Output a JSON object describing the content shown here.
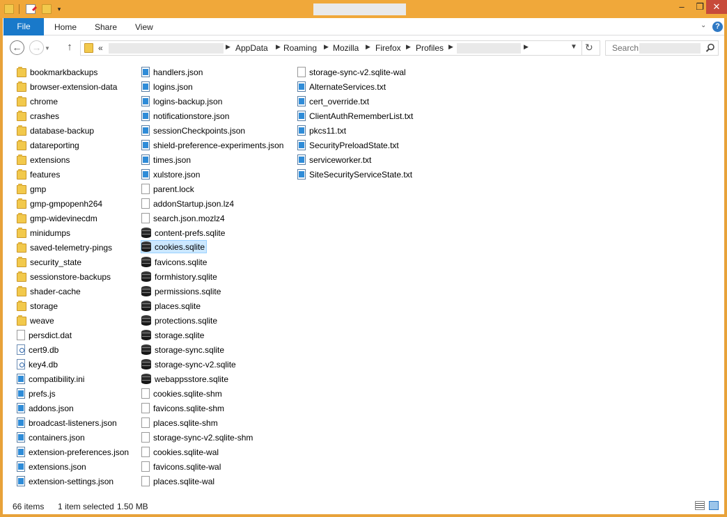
{
  "ribbon": {
    "file": "File",
    "home": "Home",
    "share": "Share",
    "view": "View",
    "help": "?"
  },
  "window": {
    "min": "–",
    "max": "❐",
    "close": "✕"
  },
  "nav": {
    "overflow": "«",
    "crumbs": [
      "AppData",
      "Roaming",
      "Mozilla",
      "Firefox",
      "Profiles"
    ],
    "search_placeholder": "Search"
  },
  "columns": [
    [
      {
        "name": "bookmarkbackups",
        "icon": "folder"
      },
      {
        "name": "browser-extension-data",
        "icon": "folder"
      },
      {
        "name": "chrome",
        "icon": "folder"
      },
      {
        "name": "crashes",
        "icon": "folder"
      },
      {
        "name": "database-backup",
        "icon": "folder"
      },
      {
        "name": "datareporting",
        "icon": "folder"
      },
      {
        "name": "extensions",
        "icon": "folder"
      },
      {
        "name": "features",
        "icon": "folder"
      },
      {
        "name": "gmp",
        "icon": "folder"
      },
      {
        "name": "gmp-gmpopenh264",
        "icon": "folder"
      },
      {
        "name": "gmp-widevinecdm",
        "icon": "folder"
      },
      {
        "name": "minidumps",
        "icon": "folder"
      },
      {
        "name": "saved-telemetry-pings",
        "icon": "folder"
      },
      {
        "name": "security_state",
        "icon": "folder"
      },
      {
        "name": "sessionstore-backups",
        "icon": "folder"
      },
      {
        "name": "shader-cache",
        "icon": "folder"
      },
      {
        "name": "storage",
        "icon": "folder"
      },
      {
        "name": "weave",
        "icon": "folder"
      },
      {
        "name": "persdict.dat",
        "icon": "doc"
      },
      {
        "name": "cert9.db",
        "icon": "cert"
      },
      {
        "name": "key4.db",
        "icon": "cert"
      },
      {
        "name": "compatibility.ini",
        "icon": "blue"
      },
      {
        "name": "prefs.js",
        "icon": "blue"
      },
      {
        "name": "addons.json",
        "icon": "blue"
      },
      {
        "name": "broadcast-listeners.json",
        "icon": "blue"
      },
      {
        "name": "containers.json",
        "icon": "blue"
      },
      {
        "name": "extension-preferences.json",
        "icon": "blue"
      },
      {
        "name": "extensions.json",
        "icon": "blue"
      },
      {
        "name": "extension-settings.json",
        "icon": "blue"
      }
    ],
    [
      {
        "name": "handlers.json",
        "icon": "blue"
      },
      {
        "name": "logins.json",
        "icon": "blue"
      },
      {
        "name": "logins-backup.json",
        "icon": "blue"
      },
      {
        "name": "notificationstore.json",
        "icon": "blue"
      },
      {
        "name": "sessionCheckpoints.json",
        "icon": "blue"
      },
      {
        "name": "shield-preference-experiments.json",
        "icon": "blue"
      },
      {
        "name": "times.json",
        "icon": "blue"
      },
      {
        "name": "xulstore.json",
        "icon": "blue"
      },
      {
        "name": "parent.lock",
        "icon": "doc"
      },
      {
        "name": "addonStartup.json.lz4",
        "icon": "doc"
      },
      {
        "name": "search.json.mozlz4",
        "icon": "doc"
      },
      {
        "name": "content-prefs.sqlite",
        "icon": "db"
      },
      {
        "name": "cookies.sqlite",
        "icon": "db",
        "selected": true
      },
      {
        "name": "favicons.sqlite",
        "icon": "db"
      },
      {
        "name": "formhistory.sqlite",
        "icon": "db"
      },
      {
        "name": "permissions.sqlite",
        "icon": "db"
      },
      {
        "name": "places.sqlite",
        "icon": "db"
      },
      {
        "name": "protections.sqlite",
        "icon": "db"
      },
      {
        "name": "storage.sqlite",
        "icon": "db"
      },
      {
        "name": "storage-sync.sqlite",
        "icon": "db"
      },
      {
        "name": "storage-sync-v2.sqlite",
        "icon": "db"
      },
      {
        "name": "webappsstore.sqlite",
        "icon": "db"
      },
      {
        "name": "cookies.sqlite-shm",
        "icon": "doc"
      },
      {
        "name": "favicons.sqlite-shm",
        "icon": "doc"
      },
      {
        "name": "places.sqlite-shm",
        "icon": "doc"
      },
      {
        "name": "storage-sync-v2.sqlite-shm",
        "icon": "doc"
      },
      {
        "name": "cookies.sqlite-wal",
        "icon": "doc"
      },
      {
        "name": "favicons.sqlite-wal",
        "icon": "doc"
      },
      {
        "name": "places.sqlite-wal",
        "icon": "doc"
      }
    ],
    [
      {
        "name": "storage-sync-v2.sqlite-wal",
        "icon": "doc"
      },
      {
        "name": "AlternateServices.txt",
        "icon": "blue"
      },
      {
        "name": "cert_override.txt",
        "icon": "blue"
      },
      {
        "name": "ClientAuthRememberList.txt",
        "icon": "blue"
      },
      {
        "name": "pkcs11.txt",
        "icon": "blue"
      },
      {
        "name": "SecurityPreloadState.txt",
        "icon": "blue"
      },
      {
        "name": "serviceworker.txt",
        "icon": "blue"
      },
      {
        "name": "SiteSecurityServiceState.txt",
        "icon": "blue"
      }
    ]
  ],
  "status": {
    "count": "66 items",
    "selected": "1 item selected",
    "size": "1.50 MB"
  }
}
